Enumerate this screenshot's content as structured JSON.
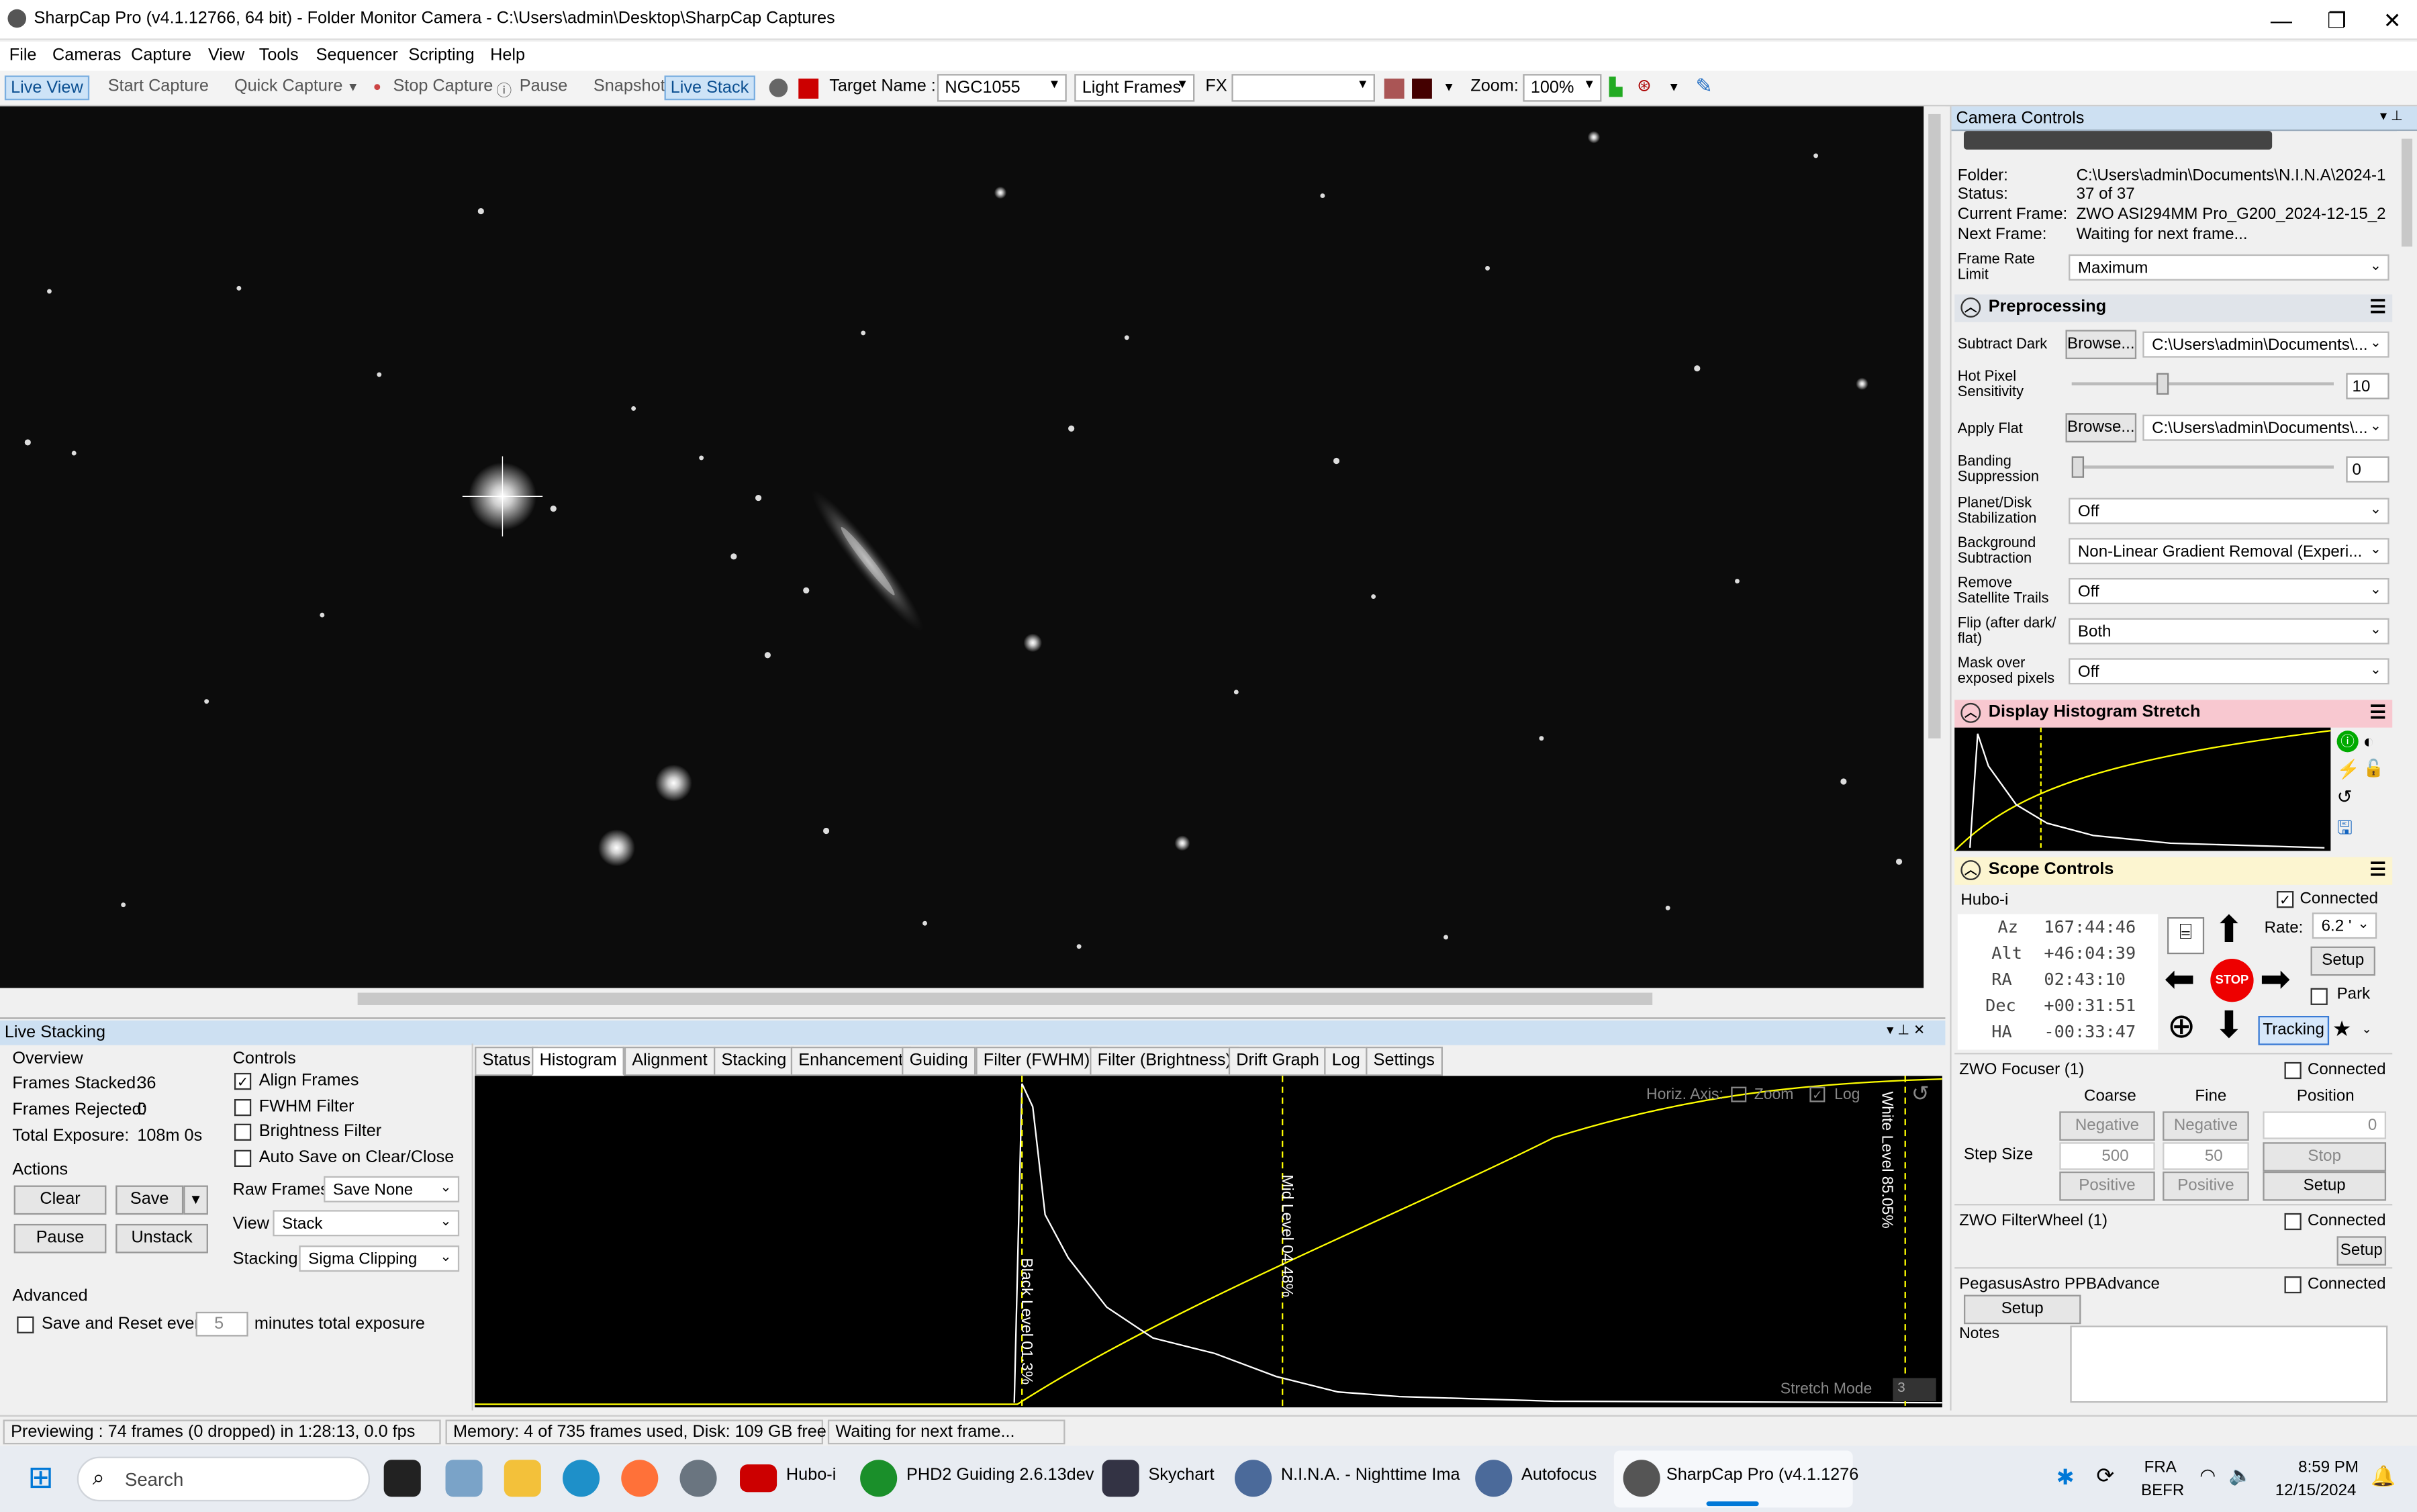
{
  "window": {
    "title": "SharpCap Pro (v4.1.12766, 64 bit) - Folder Monitor Camera - C:\\Users\\admin\\Desktop\\SharpCap Captures",
    "minimize": "—",
    "maximize": "❐",
    "close": "✕"
  },
  "menu": [
    "File",
    "Cameras",
    "Capture",
    "View",
    "Tools",
    "Sequencer",
    "Scripting",
    "Help"
  ],
  "toolbar": {
    "live_view": "Live View",
    "start_capture": "Start Capture",
    "quick_capture": "Quick Capture",
    "stop_capture": "Stop Capture",
    "pause": "Pause",
    "snapshot": "Snapshot",
    "live_stack": "Live Stack",
    "target_label": "Target Name :",
    "target_value": "NGC1055",
    "frame_type": "Light Frames",
    "fx_label": "FX",
    "zoom_label": "Zoom:",
    "zoom_value": "100%"
  },
  "camera_controls": {
    "title": "Camera Controls",
    "folder_label": "Folder:",
    "folder_value": "C:\\Users\\admin\\Documents\\N.I.N.A\\2024-1",
    "status_label": "Status:",
    "status_value": "37 of 37",
    "current_frame_label": "Current Frame:",
    "current_frame_value": "ZWO ASI294MM Pro_G200_2024-12-15_2",
    "next_frame_label": "Next Frame:",
    "next_frame_value": "Waiting for next frame...",
    "frame_rate_label": "Frame Rate Limit",
    "frame_rate_value": "Maximum"
  },
  "preprocessing": {
    "title": "Preprocessing",
    "subtract_dark_label": "Subtract Dark",
    "browse": "Browse...",
    "dark_path": "C:\\Users\\admin\\Documents\\...",
    "hot_pixel_label": "Hot Pixel Sensitivity",
    "hot_pixel_value": "10",
    "apply_flat_label": "Apply Flat",
    "flat_path": "C:\\Users\\admin\\Documents\\...",
    "banding_label": "Banding Suppression",
    "banding_value": "0",
    "planet_label": "Planet/Disk Stabilization",
    "planet_value": "Off",
    "background_label": "Background Subtraction",
    "background_value": "Non-Linear Gradient Removal (Experi...",
    "satellite_label": "Remove Satellite Trails",
    "satellite_value": "Off",
    "flip_label": "Flip (after dark/ flat)",
    "flip_value": "Both",
    "mask_label": "Mask over exposed pixels",
    "mask_value": "Off"
  },
  "histogram_stretch": {
    "title": "Display Histogram Stretch"
  },
  "scope": {
    "title": "Scope Controls",
    "mount": "Hubo-i",
    "connected": "Connected",
    "az_label": "Az",
    "az": "167:44:46",
    "alt_label": "Alt",
    "alt": "+46:04:39",
    "ra_label": "RA",
    "ra": "02:43:10",
    "dec_label": "Dec",
    "dec": "+00:31:51",
    "ha_label": "HA",
    "ha": "-00:33:47",
    "rate_label": "Rate:",
    "rate": "6.2 '",
    "setup": "Setup",
    "park": "Park",
    "tracking": "Tracking",
    "stop": "STOP"
  },
  "focuser": {
    "title": "ZWO Focuser (1)",
    "connected": "Connected",
    "coarse": "Coarse",
    "fine": "Fine",
    "position": "Position",
    "position_value": "0",
    "negative": "Negative",
    "step_size_label": "Step Size",
    "coarse_step": "500",
    "fine_step": "50",
    "stop": "Stop",
    "positive": "Positive",
    "setup": "Setup"
  },
  "filterwheel": {
    "title": "ZWO FilterWheel (1)",
    "connected": "Connected",
    "setup": "Setup"
  },
  "pegasus": {
    "title": "PegasusAstro PPBAdvance",
    "connected": "Connected",
    "setup": "Setup"
  },
  "notes": {
    "label": "Notes"
  },
  "live_stacking": {
    "title": "Live Stacking",
    "overview": "Overview",
    "frames_stacked_label": "Frames Stacked:",
    "frames_stacked": "36",
    "frames_rejected_label": "Frames Rejected:",
    "frames_rejected": "0",
    "total_exposure_label": "Total Exposure:",
    "total_exposure": "108m 0s",
    "actions": "Actions",
    "clear": "Clear",
    "save": "Save",
    "pause": "Pause",
    "unstack": "Unstack",
    "advanced": "Advanced",
    "save_reset_pre": "Save and Reset every",
    "save_reset_value": "5",
    "save_reset_post": "minutes total exposure",
    "controls": "Controls",
    "align_frames": "Align Frames",
    "fwhm_filter": "FWHM Filter",
    "brightness_filter": "Brightness Filter",
    "auto_save": "Auto Save on Clear/Close",
    "raw_frames_label": "Raw Frames",
    "raw_frames_value": "Save None",
    "view_label": "View",
    "view_value": "Stack",
    "stacking_label": "Stacking",
    "stacking_value": "Sigma Clipping",
    "tabs": [
      "Status",
      "Histogram",
      "Alignment",
      "Stacking",
      "Enhancement",
      "Guiding",
      "Filter (FWHM)",
      "Filter (Brightness)",
      "Drift Graph",
      "Log",
      "Settings"
    ],
    "histogram": {
      "horiz_axis": "Horiz. Axis:",
      "zoom": "Zoom",
      "log": "Log",
      "black_level": "Black Level 01.3%",
      "mid_level": "Mid Level 04.48%",
      "white_level": "White Level 85.05%",
      "stretch_mode": "Stretch Mode",
      "stretch_mode_value": "3"
    }
  },
  "statusbar": {
    "previewing": "Previewing : 74 frames (0 dropped) in 1:28:13, 0.0 fps",
    "memory": "Memory: 4 of 735 frames used, Disk: 109 GB free",
    "waiting": "Waiting for next frame..."
  },
  "taskbar": {
    "search": "Search",
    "apps": [
      "Hubo-i",
      "PHD2 Guiding 2.6.13dev",
      "Skychart",
      "N.I.N.A. - Nighttime Ima",
      "Autofocus",
      "SharpCap Pro (v4.1.1276"
    ],
    "lang": "FRA",
    "locale": "BEFR",
    "time": "8:59 PM",
    "date": "12/15/2024"
  },
  "colors": {
    "accent": "#0078d7",
    "stretch_header": "#f8c8d0",
    "scope_header": "#fcf5d0",
    "curve": "#ffff00"
  }
}
